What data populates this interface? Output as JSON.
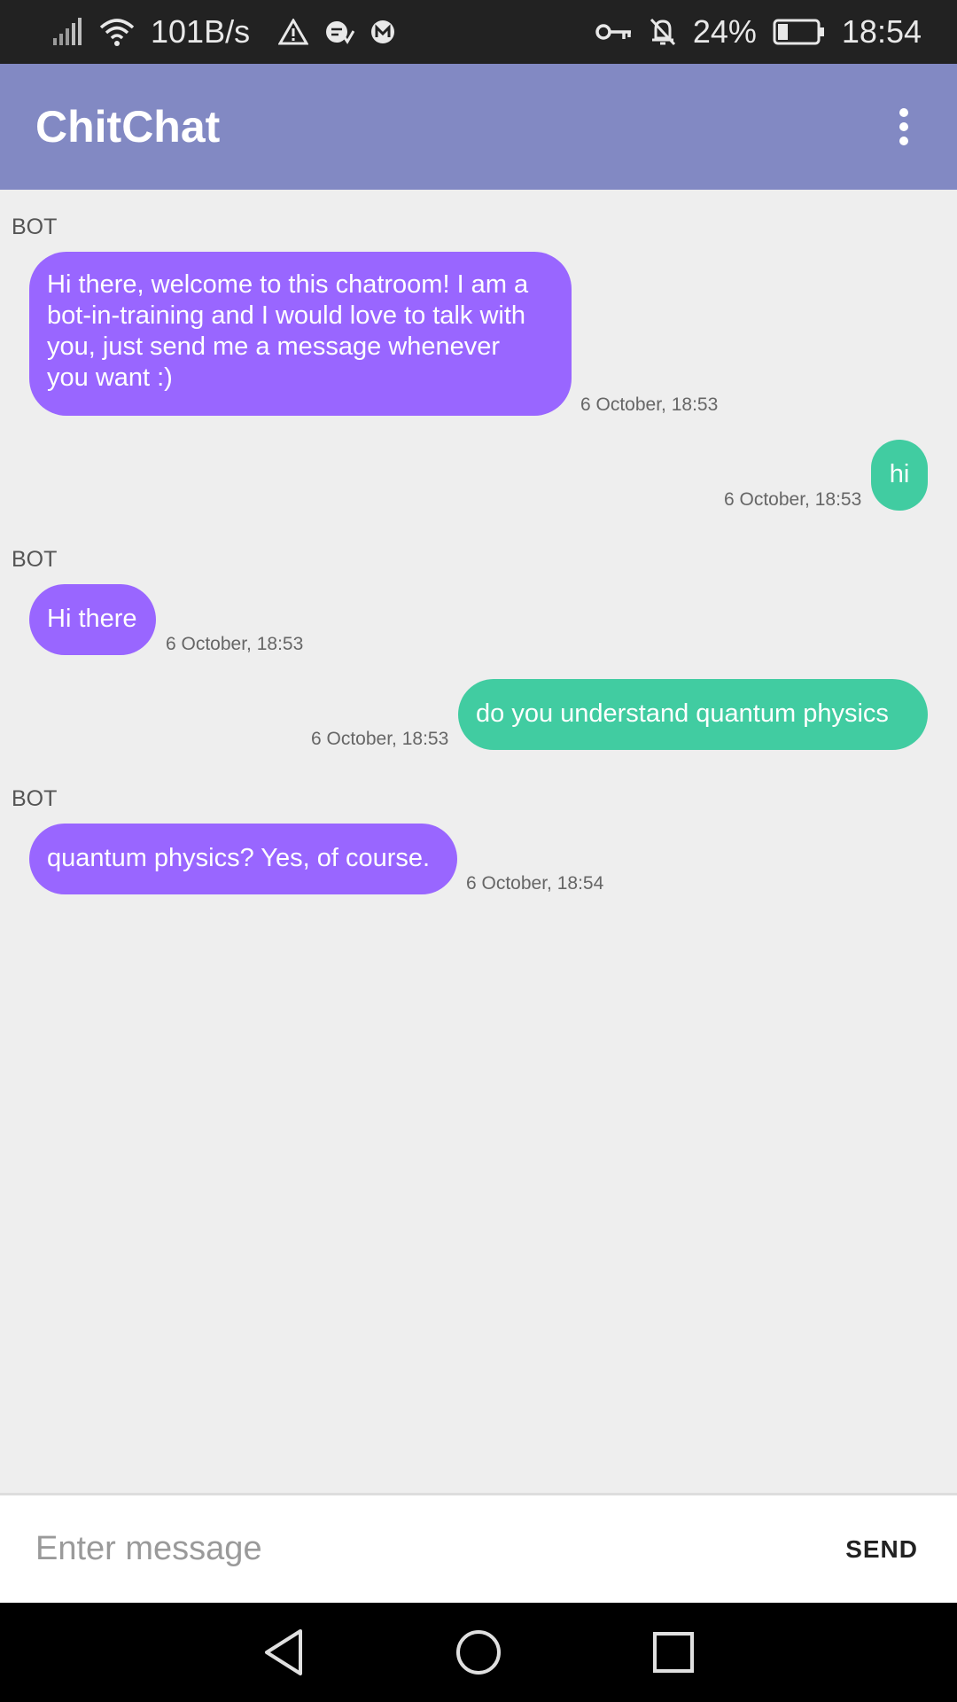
{
  "status_bar": {
    "speed": "101B/s",
    "battery": "24%",
    "time": "18:54",
    "icons": [
      "signal-icon",
      "wifi-icon",
      "warning-icon",
      "app-notification-icon",
      "m-notification-icon",
      "vpn-key-icon",
      "bell-off-icon",
      "battery-icon"
    ]
  },
  "app_bar": {
    "title": "ChitChat",
    "menu_icon": "more-vertical-icon",
    "color": "#8289c3"
  },
  "messages": [
    {
      "side": "bot",
      "sender": "BOT",
      "lines": [
        "Hi there, welcome to this chatroom! I am a",
        "bot-in-training and I would love to talk with",
        "you, just send me a message whenever",
        "you want :)"
      ],
      "time": "6 October, 18:53"
    },
    {
      "side": "user",
      "lines": [
        "hi"
      ],
      "time": "6 October, 18:53"
    },
    {
      "side": "bot",
      "sender": "BOT",
      "lines": [
        "Hi there"
      ],
      "time": "6 October, 18:53"
    },
    {
      "side": "user",
      "lines": [
        "do you understand quantum physics"
      ],
      "time": "6 October, 18:53"
    },
    {
      "side": "bot",
      "sender": "BOT",
      "lines": [
        "quantum physics? Yes, of course."
      ],
      "time": "6 October, 18:54"
    }
  ],
  "colors": {
    "bot_bubble": "#9966ff",
    "user_bubble": "#41cca1"
  },
  "input": {
    "placeholder": "Enter message",
    "value": "",
    "send_label": "SEND"
  },
  "nav": {
    "icons": [
      "back-icon",
      "home-icon",
      "recents-icon"
    ]
  }
}
